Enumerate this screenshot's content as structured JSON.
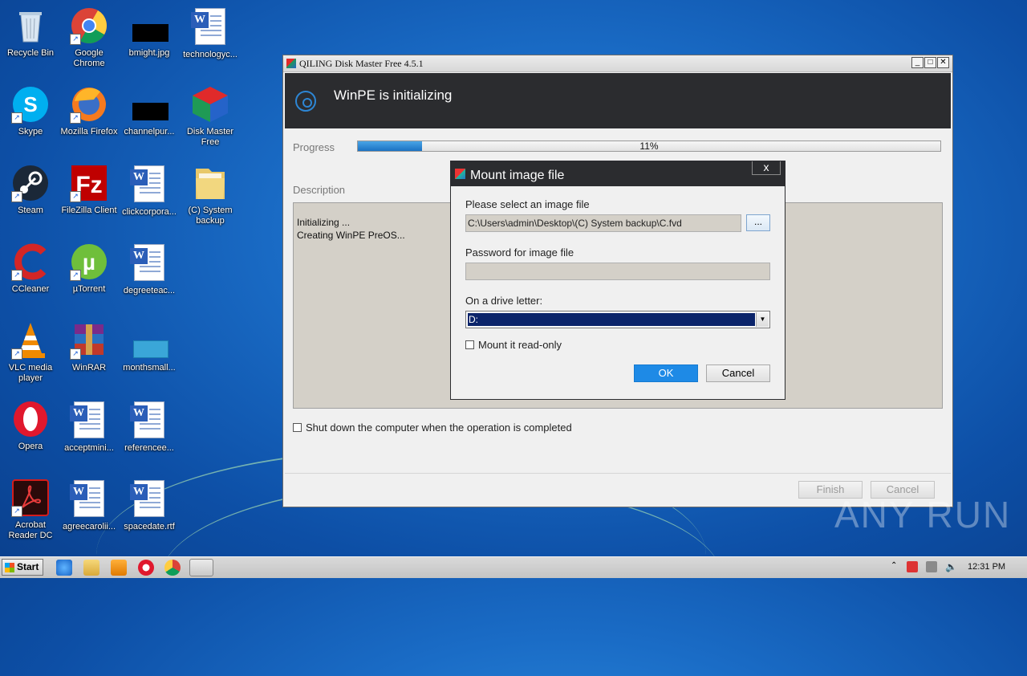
{
  "desktop": {
    "icons": [
      {
        "label": "Recycle Bin"
      },
      {
        "label": "Google Chrome"
      },
      {
        "label": "bmight.jpg"
      },
      {
        "label": "technologyc..."
      },
      {
        "label": "Skype"
      },
      {
        "label": "Mozilla Firefox"
      },
      {
        "label": "channelpur..."
      },
      {
        "label": "Disk Master Free"
      },
      {
        "label": "Steam"
      },
      {
        "label": "FileZilla Client"
      },
      {
        "label": "clickcorpora..."
      },
      {
        "label": "(C) System backup"
      },
      {
        "label": "CCleaner"
      },
      {
        "label": "µTorrent"
      },
      {
        "label": "degreeteac..."
      },
      {
        "label": "VLC media player"
      },
      {
        "label": "WinRAR"
      },
      {
        "label": "monthsmall..."
      },
      {
        "label": "Opera"
      },
      {
        "label": "acceptmini..."
      },
      {
        "label": "referencee..."
      },
      {
        "label": "Acrobat Reader DC"
      },
      {
        "label": "agreecarolii..."
      },
      {
        "label": "spacedate.rtf"
      }
    ]
  },
  "window": {
    "title": "QILING Disk Master Free 4.5.1",
    "header_title": "WinPE is initializing",
    "progress_label": "Progress",
    "progress_text": "11%",
    "progress_value": 11,
    "description_label": "Description",
    "description_lines": [
      "Initializing ...",
      "Creating WinPE PreOS..."
    ],
    "shutdown_label": "Shut down the computer when the operation is completed",
    "finish_label": "Finish",
    "cancel_label": "Cancel"
  },
  "dialog": {
    "title": "Mount image file",
    "close_label": "x",
    "image_label": "Please select an image file",
    "image_path": "C:\\Users\\admin\\Desktop\\(C) System backup\\C.fvd",
    "browse_label": "...",
    "password_label": "Password for image file",
    "password_value": "",
    "drive_label": "On a drive letter:",
    "drive_value": "D:",
    "readonly_label": "Mount it read-only",
    "ok_label": "OK",
    "cancel_label": "Cancel"
  },
  "watermark": "ANY RUN",
  "taskbar": {
    "start_label": "Start",
    "clock": "12:31 PM"
  },
  "colors": {
    "accent": "#1e8ae6",
    "header_bg": "#2b2c2f",
    "desktop": "#1a6cc6"
  }
}
